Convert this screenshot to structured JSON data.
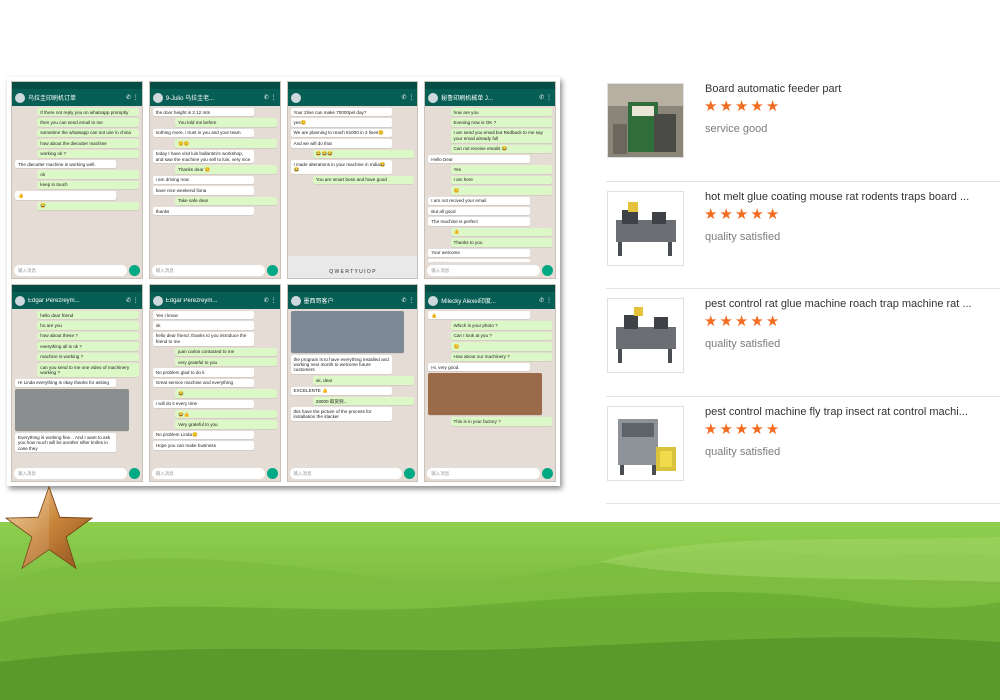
{
  "colors": {
    "accent": "#f36c21",
    "whatsapp_bar": "#075e54",
    "hills": "#7bbf3b"
  },
  "collage": {
    "phones": [
      {
        "name": "乌拉圭印刷机订单",
        "input": "输入消息",
        "messages": [
          {
            "dir": "out",
            "text": "If there not reply you on whatsapp promptly"
          },
          {
            "dir": "out",
            "text": "then you can send email to me"
          },
          {
            "dir": "out",
            "text": "sometime the whatsapp can not use in china"
          },
          {
            "dir": "out",
            "text": "how about the diecutter machine"
          },
          {
            "dir": "out",
            "text": "working ok ?"
          },
          {
            "dir": "in",
            "text": "The diecutter machine is working well."
          },
          {
            "dir": "out",
            "text": "ok"
          },
          {
            "dir": "out",
            "text": "keep in touch"
          },
          {
            "dir": "in",
            "text": "👍"
          },
          {
            "dir": "out",
            "text": "😂"
          }
        ]
      },
      {
        "name": "9-Julio 乌拉圭老...",
        "input": "输入消息",
        "messages": [
          {
            "dir": "in",
            "text": "the door height is 2.12 mts"
          },
          {
            "dir": "out",
            "text": "You told me before"
          },
          {
            "dir": "in",
            "text": "nothing more, i trust in you and your team"
          },
          {
            "dir": "out",
            "text": "😊😊"
          },
          {
            "dir": "in",
            "text": "today I have visit luis ballantini's workshop, and saw the machine you sell to luis, very nice"
          },
          {
            "dir": "out",
            "text": "Thanks dear 😊"
          },
          {
            "dir": "in",
            "text": "i am driving now"
          },
          {
            "dir": "in",
            "text": "have nice weekend fiona"
          },
          {
            "dir": "out",
            "text": "Take safe dear"
          },
          {
            "dir": "in",
            "text": "thanks"
          }
        ]
      },
      {
        "name": "",
        "input": "输入消息",
        "keyboard": "Q W E R T Y U I O P",
        "messages": [
          {
            "dir": "in",
            "text": "Your 2line can make 70000pel day?"
          },
          {
            "dir": "in",
            "text": "yes😊"
          },
          {
            "dir": "in",
            "text": "We are planning to reach 81000 in 3 lines😊"
          },
          {
            "dir": "in",
            "text": "And we will do that"
          },
          {
            "dir": "out",
            "text": "😂😂😂"
          },
          {
            "dir": "in",
            "text": "I made alterations in your machine in India😂😂"
          },
          {
            "dir": "out",
            "text": "You are smart boss and have good"
          }
        ]
      },
      {
        "name": "秘鲁印刷机械单 J...",
        "input": "输入消息",
        "messages": [
          {
            "dir": "out",
            "text": "how are you"
          },
          {
            "dir": "out",
            "text": "Evening now is OK ?"
          },
          {
            "dir": "out",
            "text": "I am send you email but Redback to me say your email already full"
          },
          {
            "dir": "out",
            "text": "Can not receive emails 😂"
          },
          {
            "dir": "in",
            "text": "Hello Dear"
          },
          {
            "dir": "out",
            "text": "Yes"
          },
          {
            "dir": "out",
            "text": "I am here"
          },
          {
            "dir": "out",
            "text": "😊"
          },
          {
            "dir": "in",
            "text": "I am not recived your email"
          },
          {
            "dir": "in",
            "text": "But all good"
          },
          {
            "dir": "in",
            "text": "The machine is perfect"
          },
          {
            "dir": "out",
            "text": "👍"
          },
          {
            "dir": "out",
            "text": "Thanks to you"
          },
          {
            "dir": "in",
            "text": "Your welcome"
          },
          {
            "dir": "in",
            "text": "Thanks"
          }
        ]
      },
      {
        "name": "Edgar Perezreym...",
        "input": "输入消息",
        "messages": [
          {
            "dir": "out",
            "text": "hello dear friend"
          },
          {
            "dir": "out",
            "text": "ho are you"
          },
          {
            "dir": "out",
            "text": "how about these ?"
          },
          {
            "dir": "out",
            "text": "everything all is ok ?"
          },
          {
            "dir": "out",
            "text": "machine is working ?"
          },
          {
            "dir": "out",
            "text": "can you send to me one video of machinery working ?"
          },
          {
            "dir": "in",
            "text": "Hi Linda everything is okay thanks for asking"
          },
          {
            "dir": "pic",
            "text": ""
          },
          {
            "dir": "in",
            "text": "Everything is working fine... And I want to ask you how much will be another sifter knifes in case they"
          }
        ]
      },
      {
        "name": "Edgar Perezreym...",
        "input": "输入消息",
        "messages": [
          {
            "dir": "in",
            "text": "Yes I know"
          },
          {
            "dir": "in",
            "text": "ok"
          },
          {
            "dir": "in",
            "text": "hello dear friend ,thanks to you introduce the friend to me"
          },
          {
            "dir": "out",
            "text": "juan carlos contacted to me"
          },
          {
            "dir": "out",
            "text": "very grateful to you"
          },
          {
            "dir": "in",
            "text": "No problem glad to do it"
          },
          {
            "dir": "in",
            "text": "Great service machine and everything"
          },
          {
            "dir": "out",
            "text": "😂"
          },
          {
            "dir": "in",
            "text": "I will do it every time"
          },
          {
            "dir": "out",
            "text": "😂👍"
          },
          {
            "dir": "out",
            "text": "Very grateful to you"
          },
          {
            "dir": "in",
            "text": "No problem Linda😊"
          },
          {
            "dir": "in",
            "text": "Hope you can make business"
          }
        ]
      },
      {
        "name": "墨西哥客户",
        "input": "输入消息",
        "messages": [
          {
            "dir": "pic",
            "text": "",
            "tone": "grey"
          },
          {
            "dir": "in",
            "text": "the program is to have everything installed and working next month to welcome future customers"
          },
          {
            "dir": "out",
            "text": "ok, dear"
          },
          {
            "dir": "in",
            "text": "EXCELENTE 👍"
          },
          {
            "dir": "out",
            "text": "28000 取货到..."
          },
          {
            "dir": "in",
            "text": "this have the picture of the process for installation the stacker"
          }
        ]
      },
      {
        "name": "Milecky Alexei印度...",
        "input": "输入消息",
        "messages": [
          {
            "dir": "in",
            "text": "👍"
          },
          {
            "dir": "out",
            "text": "Which is your photo ?"
          },
          {
            "dir": "out",
            "text": "Can I look at you ?"
          },
          {
            "dir": "out",
            "text": "😊"
          },
          {
            "dir": "out",
            "text": "How about our machinery ?"
          },
          {
            "dir": "in",
            "text": "Hi, very good."
          },
          {
            "dir": "pic",
            "text": "",
            "tone": "warm"
          },
          {
            "dir": "out",
            "text": "This is in your factory ?"
          }
        ]
      }
    ]
  },
  "reviews": [
    {
      "title": "Board automatic feeder part",
      "rating": 5,
      "comment": "service good"
    },
    {
      "title": "hot melt glue coating mouse rat rodents traps board ...",
      "rating": 5,
      "comment": "quality satisfied"
    },
    {
      "title": "pest control rat glue machine roach trap machine rat ...",
      "rating": 5,
      "comment": "quality satisfied"
    },
    {
      "title": "pest control machine fly trap insect rat control machi...",
      "rating": 5,
      "comment": "quality satisfied"
    }
  ]
}
